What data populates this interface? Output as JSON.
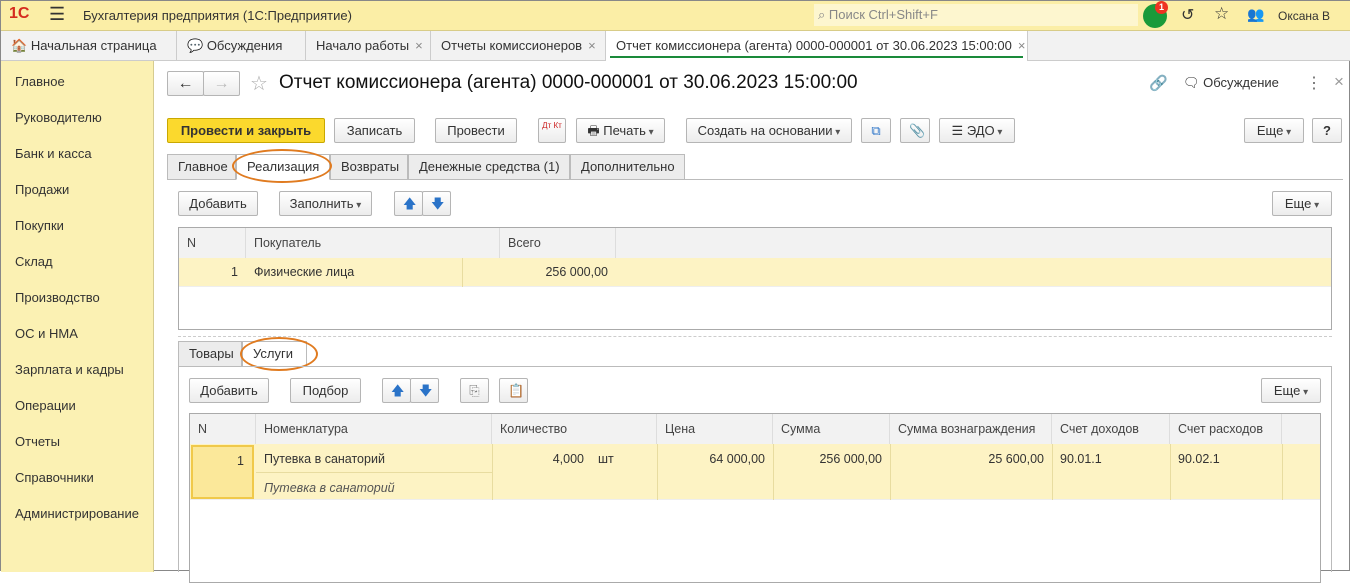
{
  "app": {
    "title": "Бухгалтерия предприятия  (1С:Предприятие)",
    "search_placeholder": "Поиск Ctrl+Shift+F",
    "notifications": "1",
    "user": "Оксана В"
  },
  "tabs": [
    {
      "label": "Начальная страница"
    },
    {
      "label": "Обсуждения"
    },
    {
      "label": "Начало работы"
    },
    {
      "label": "Отчеты комиссионеров"
    },
    {
      "label": "Отчет комиссионера (агента) 0000-000001 от 30.06.2023 15:00:00"
    }
  ],
  "sidebar": [
    "Главное",
    "Руководителю",
    "Банк и касса",
    "Продажи",
    "Покупки",
    "Склад",
    "Производство",
    "ОС и НМА",
    "Зарплата и кадры",
    "Операции",
    "Отчеты",
    "Справочники",
    "Администрирование"
  ],
  "form": {
    "title": "Отчет комиссионера (агента) 0000-000001 от 30.06.2023 15:00:00",
    "discussion": "Обсуждение",
    "toolbar": {
      "post_close": "Провести и закрыть",
      "save": "Записать",
      "post": "Провести",
      "dtkt": "Дт Кт",
      "print": "Печать",
      "create_based": "Создать на основании",
      "edo": "ЭДО",
      "more": "Еще",
      "help": "?"
    },
    "tabs": [
      "Главное",
      "Реализация",
      "Возвраты",
      "Денежные средства (1)",
      "Дополнительно"
    ],
    "buyers": {
      "add": "Добавить",
      "fill": "Заполнить",
      "more": "Еще",
      "columns": [
        "N",
        "Покупатель",
        "Всего"
      ],
      "rows": [
        {
          "n": "1",
          "buyer": "Физические лица",
          "total": "256 000,00"
        }
      ]
    },
    "subtabs": [
      "Товары",
      "Услуги"
    ],
    "services": {
      "add": "Добавить",
      "pick": "Подбор",
      "more": "Еще",
      "columns": [
        "N",
        "Номенклатура",
        "Количество",
        "Цена",
        "Сумма",
        "Сумма вознаграждения",
        "Счет доходов",
        "Счет расходов"
      ],
      "rows": [
        {
          "n": "1",
          "item": "Путевка в санаторий",
          "item_sub": "Путевка в санаторий",
          "qty": "4,000",
          "unit": "шт",
          "price": "64 000,00",
          "sum": "256 000,00",
          "reward": "25 600,00",
          "income": "90.01.1",
          "expense": "90.02.1"
        }
      ]
    }
  },
  "colors": {
    "accent": "#fbd92d",
    "highlight": "#fdf3c4",
    "annotation": "#e07b20"
  }
}
